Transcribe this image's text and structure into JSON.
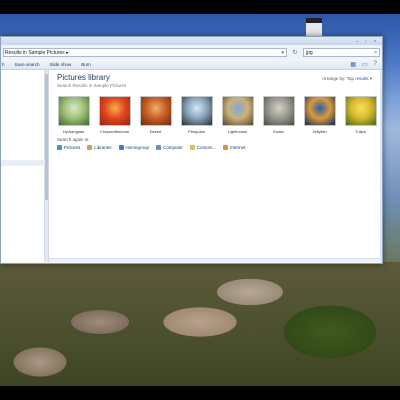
{
  "window": {
    "address": "Results in Sample Pictures",
    "search_query": "jpg",
    "controls": [
      "–",
      "▫",
      "×"
    ]
  },
  "toolbar": {
    "items": [
      "h",
      "Save search",
      "Slide show",
      "Burn"
    ]
  },
  "library": {
    "title": "Pictures library",
    "subtitle": "Search Results in Sample Pictures",
    "arrange_label": "Arrange by:",
    "arrange_value": "Top results"
  },
  "pictures": [
    {
      "name": "Hydrangeas",
      "colors": [
        "#d9e8c8",
        "#9fbf7a",
        "#3f6b2a"
      ]
    },
    {
      "name": "Chrysanthemum",
      "colors": [
        "#f9b04a",
        "#e0481e",
        "#a32010"
      ]
    },
    {
      "name": "Desert",
      "colors": [
        "#f3b16f",
        "#c85f25",
        "#6b2b12"
      ]
    },
    {
      "name": "Penguins",
      "colors": [
        "#d7e7f4",
        "#8aa6bf",
        "#2b2b33"
      ]
    },
    {
      "name": "Lighthouse",
      "colors": [
        "#7fa8d6",
        "#c9b27a",
        "#5a4330"
      ]
    },
    {
      "name": "Koala",
      "colors": [
        "#d7d1c4",
        "#9a9a92",
        "#4a4a46"
      ]
    },
    {
      "name": "Jellyfish",
      "colors": [
        "#2a5fa0",
        "#d99a3c",
        "#0d2b5c"
      ]
    },
    {
      "name": "Tulips",
      "colors": [
        "#f4e25a",
        "#d9b82c",
        "#3e6b1c"
      ]
    }
  ],
  "search_again": {
    "label": "Search again in:",
    "places": [
      {
        "label": "Pictures",
        "color": "#4a8ed4"
      },
      {
        "label": "Libraries",
        "color": "#c9a24a"
      },
      {
        "label": "Homegroup",
        "color": "#3b7bd6"
      },
      {
        "label": "Computer",
        "color": "#6a8fb8"
      },
      {
        "label": "Custom...",
        "color": "#e2c04a"
      },
      {
        "label": "Internet",
        "color": "#d8962c"
      }
    ]
  }
}
